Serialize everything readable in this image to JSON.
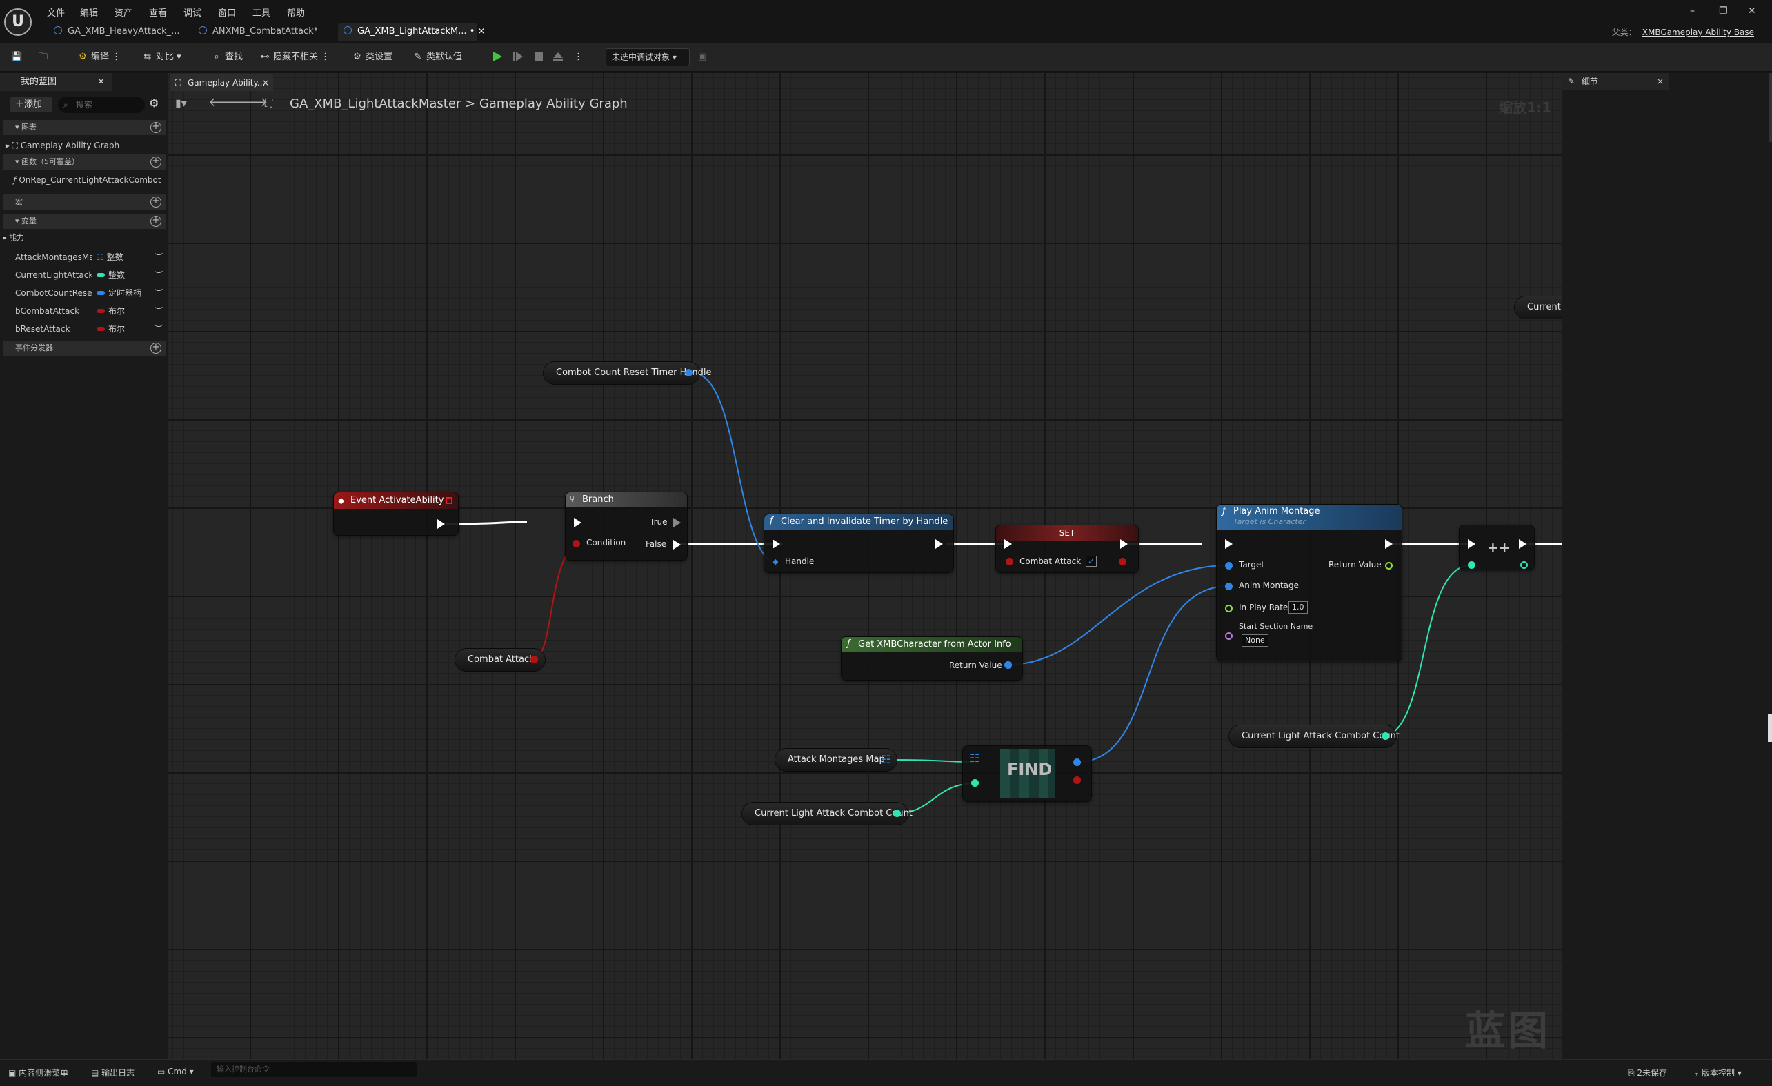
{
  "titlebar": {
    "menus": [
      "文件",
      "编辑",
      "资产",
      "查看",
      "调试",
      "窗口",
      "工具",
      "帮助"
    ],
    "tabs": [
      {
        "label": "GA_XMB_HeavyAttack_..."
      },
      {
        "label": "ANXMB_CombatAttack*"
      },
      {
        "label": "GA_XMB_LightAttackM... •"
      }
    ],
    "tab_close": "×",
    "parent_label": "父类：",
    "parent_value": "XMBGameplay Ability Base",
    "window_controls": [
      "–",
      "❐",
      "✕"
    ]
  },
  "toolbar": {
    "compile": "编译",
    "diff": "对比",
    "find": "查找",
    "hide_unrelated": "隐藏不相关",
    "class_settings": "类设置",
    "class_defaults": "类默认值",
    "debug_select": "未选中调试对象"
  },
  "left_panel": {
    "tab": "我的蓝图",
    "add": "添加",
    "search_placeholder": "搜索",
    "sections": {
      "graphs": "图表",
      "functions": "函数（5可覆盖）",
      "macros": "宏",
      "variables": "变量",
      "dispatchers": "事件分发器"
    },
    "graph_item": "Gameplay Ability Graph",
    "function_item": "OnRep_CurrentLightAttackCombot",
    "var_group": "能力",
    "variables": [
      {
        "name": "AttackMontagesMa",
        "type": "整数",
        "color": "#2f86e6"
      },
      {
        "name": "CurrentLightAttackC",
        "type": "整数",
        "color": "#2ee6b4"
      },
      {
        "name": "CombotCountReset",
        "type": "定时器柄",
        "color": "#2f86e6"
      },
      {
        "name": "bCombatAttack",
        "type": "布尔",
        "color": "#b01515"
      },
      {
        "name": "bResetAttack",
        "type": "布尔",
        "color": "#b01515"
      }
    ]
  },
  "graph": {
    "tab": "Gameplay Ability...",
    "breadcrumb_root": "GA_XMB_LightAttackMaster",
    "breadcrumb_sep": ">",
    "breadcrumb_leaf": "Gameplay Ability Graph",
    "zoom": "缩放1:1",
    "watermark": "蓝图",
    "nodes": {
      "event_activate": "Event ActivateAbility",
      "branch": {
        "title": "Branch",
        "true": "True",
        "condition": "Condition",
        "false": "False"
      },
      "combat_attack_get": "Combat Attack",
      "timer_handle_get": "Combot Count Reset Timer Handle",
      "clear_timer": {
        "title": "Clear and Invalidate Timer by Handle",
        "handle": "Handle"
      },
      "set": {
        "title": "SET",
        "pin": "Combat Attack"
      },
      "get_character": {
        "title": "Get XMBCharacter from Actor Info",
        "ret": "Return Value"
      },
      "play_montage": {
        "title": "Play Anim Montage",
        "subtitle": "Target is Character",
        "target": "Target",
        "montage": "Anim Montage",
        "rate": "In Play Rate",
        "rate_val": "1.0",
        "section": "Start Section Name",
        "section_val": "None",
        "ret": "Return Value"
      },
      "increment": "++",
      "current_partial": "Current l",
      "attack_map_get": "Attack Montages Map",
      "find": "FIND",
      "combo_count_get_1": "Current Light Attack Combot Count",
      "combo_count_get_2": "Current Light Attack Combot Count"
    }
  },
  "right_panel": {
    "tab": "细节"
  },
  "statusbar": {
    "drawer": "内容侧滑菜单",
    "log": "输出日志",
    "cmd": "Cmd",
    "cmd_placeholder": "输入控制台命令",
    "unsaved": "2未保存",
    "source": "版本控制"
  },
  "colors": {
    "exec": "#ffffff",
    "bool": "#b01515",
    "object": "#2f86e6",
    "int": "#2ee6b4",
    "name": "#b47bd6",
    "float": "#8ee23a"
  }
}
